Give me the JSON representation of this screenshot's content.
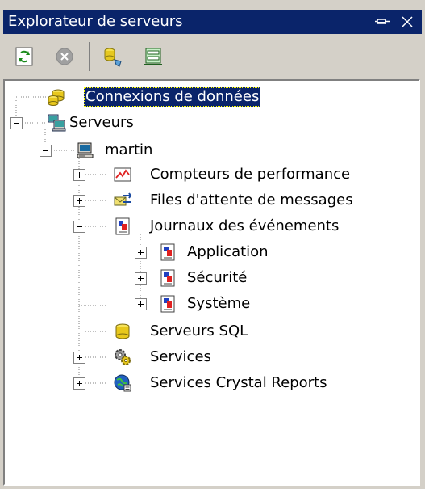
{
  "window": {
    "title": "Explorateur de serveurs",
    "pin_icon": "pin-icon",
    "close_icon": "close-icon",
    "title_bg": "#0a246a"
  },
  "toolbar": {
    "buttons": [
      {
        "name": "refresh-button",
        "icon": "refresh-icon"
      },
      {
        "name": "stop-button",
        "icon": "stop-icon"
      },
      {
        "name": "connect-database-button",
        "icon": "connect-database-icon"
      },
      {
        "name": "connect-server-button",
        "icon": "connect-server-icon"
      }
    ]
  },
  "tree": {
    "nodes": [
      {
        "label": "Connexions de données",
        "icon": "data-connections-icon",
        "selected": true
      },
      {
        "label": "Serveurs",
        "icon": "servers-icon",
        "expanded": true
      },
      {
        "label": "martin",
        "icon": "computer-icon",
        "expanded": true
      },
      {
        "label": "Compteurs de performance",
        "icon": "performance-counter-icon",
        "expanded": false
      },
      {
        "label": "Files d'attente de messages",
        "icon": "message-queue-icon",
        "expanded": false
      },
      {
        "label": "Journaux des événements",
        "icon": "event-log-icon",
        "expanded": true
      },
      {
        "label": "Application",
        "icon": "event-log-icon",
        "expanded": false
      },
      {
        "label": "Sécurité",
        "icon": "event-log-icon",
        "expanded": false
      },
      {
        "label": "Système",
        "icon": "event-log-icon",
        "expanded": false
      },
      {
        "label": "Serveurs SQL",
        "icon": "sql-server-icon"
      },
      {
        "label": "Services",
        "icon": "services-icon",
        "expanded": false
      },
      {
        "label": "Services Crystal Reports",
        "icon": "crystal-reports-icon",
        "expanded": false
      }
    ]
  },
  "colors": {
    "selection": "#0a246a",
    "panel": "#d4d0c8"
  }
}
